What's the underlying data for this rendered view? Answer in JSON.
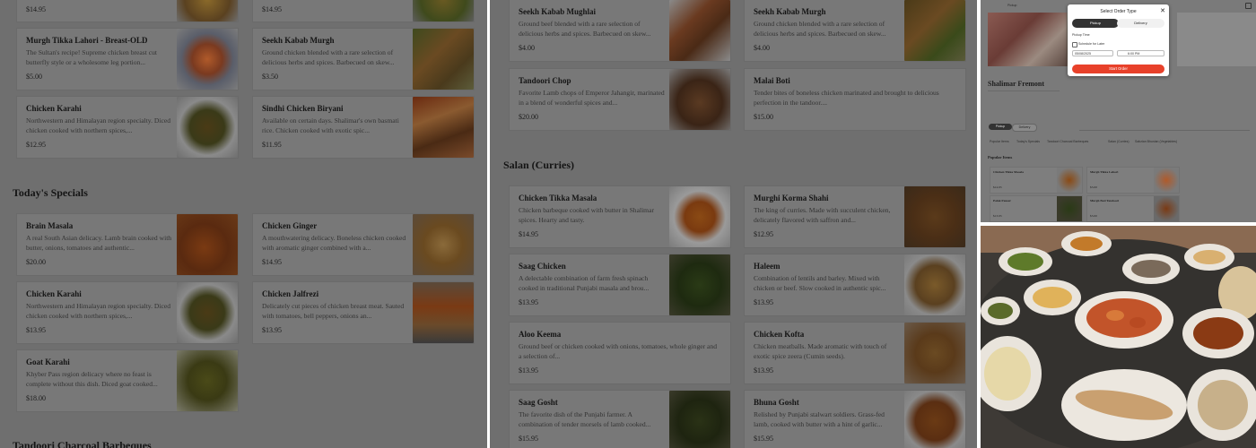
{
  "panel1": {
    "partial_prices": [
      "$14.95",
      "$14.95"
    ],
    "items_top": [
      {
        "name": "Murgh Tikka Lahori - Breast-OLD",
        "desc": "The Sultan's recipe! Supreme chicken breast cut butterfly style or a wholesome leg portion...",
        "price": "$5.00"
      },
      {
        "name": "Seekh Kabab Murgh",
        "desc": "Ground chicken blended with a rare selection of delicious herbs and spices. Barbecued on skew...",
        "price": "$3.50"
      },
      {
        "name": "Chicken Karahi",
        "desc": "Northwestern and Himalayan region specialty. Diced chicken cooked with northern spices,...",
        "price": "$12.95"
      },
      {
        "name": "Sindhi Chicken Biryani",
        "desc": "Available on certain days. Shalimar's own basmati rice. Chicken cooked with exotic spic...",
        "price": "$11.95"
      }
    ],
    "section_specials": "Today's Specials",
    "specials": [
      {
        "name": "Brain Masala",
        "desc": "A real South Asian delicacy. Lamb brain cooked with butter, onions, tomatoes and authentic...",
        "price": "$20.00"
      },
      {
        "name": "Chicken Ginger",
        "desc": "A mouthwatering delicacy. Boneless chicken cooked with aromatic ginger combined with a...",
        "price": "$14.95"
      },
      {
        "name": "Chicken Karahi",
        "desc": "Northwestern and Himalayan region specialty. Diced chicken cooked with northern spices,...",
        "price": "$13.95"
      },
      {
        "name": "Chicken Jalfrezi",
        "desc": "Delicately cut pieces of chicken breast meat. Sauted with tomatoes, bell peppers, onions an...",
        "price": "$13.95"
      },
      {
        "name": "Goat Karahi",
        "desc": "Khyber Pass region delicacy where no feast is complete without this dish. Diced goat cooked...",
        "price": "$18.00"
      }
    ],
    "section_bbq": "Tandoori Charcoal Barbeques"
  },
  "panel2": {
    "items_top": [
      {
        "name": "Seekh Kabab Mughlai",
        "desc": "Ground beef blended with a rare selection of delicious herbs and spices. Barbecued on skew...",
        "price": "$4.00"
      },
      {
        "name": "Seekh Kabab Murgh",
        "desc": "Ground chicken blended with a rare selection of delicious herbs and spices. Barbecued on skew...",
        "price": "$4.00"
      },
      {
        "name": "Tandoori Chop",
        "desc": "Favorite Lamb chops of Emperor Jahangir, marinated in a blend of wonderful spices and...",
        "price": "$20.00"
      },
      {
        "name": "Malai Boti",
        "desc": "Tender bites of boneless chicken marinated and brought to delicious perfection in the tandoor....",
        "price": "$15.00"
      }
    ],
    "section_salan": "Salan (Curries)",
    "salan": [
      {
        "name": "Chicken Tikka Masala",
        "desc": "Chicken barbeque cooked with butter in Shalimar spices. Hearty and tasty.",
        "price": "$14.95"
      },
      {
        "name": "Murghi Korma Shahi",
        "desc": "The king of curries. Made with succulent chicken, delicately flavored with saffron and...",
        "price": "$12.95"
      },
      {
        "name": "Saag Chicken",
        "desc": "A delectable combination of farm fresh spinach cooked in traditional Punjabi masala and brou...",
        "price": "$13.95"
      },
      {
        "name": "Haleem",
        "desc": "Combination of lentils and barley. Mixed with chicken or beef. Slow cooked in authentic spic...",
        "price": "$13.95"
      },
      {
        "name": "Aloo Keema",
        "desc": "Ground beef or chicken cooked with onions, tomatoes, whole ginger and a selection of...",
        "price": "$13.95"
      },
      {
        "name": "Chicken Kofta",
        "desc": "Chicken meatballs. Made aromatic with touch of exotic spice zeera (Cumin seeds).",
        "price": "$13.95"
      },
      {
        "name": "Saag Gosht",
        "desc": "The favorite dish of the Punjabi farmer. A combination of tender morsels of lamb cooked...",
        "price": "$15.95"
      },
      {
        "name": "Bhuna Gosht",
        "desc": "Relished by Punjabi stalwart soldiers. Grass-fed lamb, cooked with butter with a hint of garlic...",
        "price": "$15.95"
      }
    ]
  },
  "panel3": {
    "restaurant": "Shalimar Fremont",
    "nav": [
      "Pickup"
    ],
    "order_buttons": [
      "Pickup",
      "Delivery"
    ],
    "categories": [
      "Popular Items",
      "Today's Specials",
      "Tandoori Charcoal Barbeques",
      "Salan (Curries)",
      "Sabzian Bhunian (Vegetables)"
    ],
    "popular_title": "Popular Items",
    "popular": [
      {
        "name": "Chicken Tikka Masala",
        "price": "$14.95"
      },
      {
        "name": "Murgh Tikka Lahori",
        "price": "$5.00"
      },
      {
        "name": "Palak Paneer",
        "price": "$13.95"
      },
      {
        "name": "Murgh Boti Tandoori",
        "price": "$5.00"
      }
    ],
    "modal": {
      "title": "Select Order Type",
      "close": "✕",
      "opt_pickup": "Pickup",
      "opt_delivery": "Delivery",
      "pickup_time_label": "Pickup Time",
      "schedule_label": "Schedule for Later",
      "date_value": "05/08/2025",
      "time_value": "6:00 PM",
      "start_button": "Start Order"
    },
    "accent": "#e8412a"
  },
  "colors": {
    "overlay": "#6f6f6f",
    "card": "#787878"
  }
}
